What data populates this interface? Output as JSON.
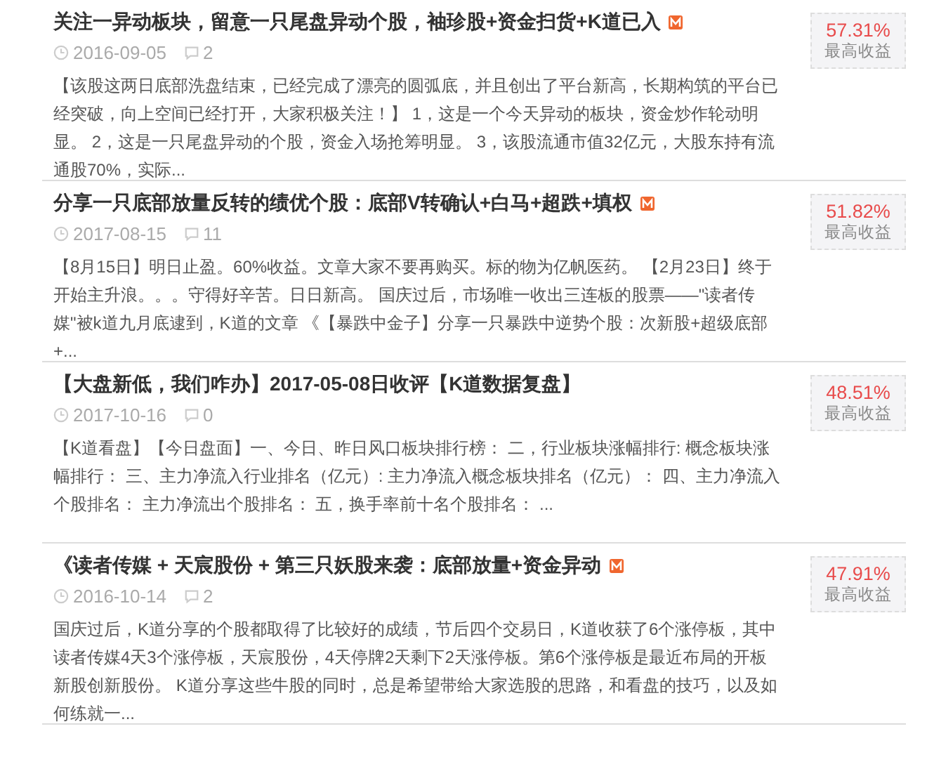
{
  "articles": [
    {
      "title": "关注一异动板块，留意一只尾盘异动个股，袖珍股+资金扫货+K道已入",
      "member": true,
      "date": "2016-09-05",
      "comments": "2",
      "summary": "【该股这两日底部洗盘结束，已经完成了漂亮的圆弧底，并且创出了平台新高，长期构筑的平台已经突破，向上空间已经打开，大家积极关注！】 1，这是一个今天异动的板块，资金炒作轮动明显。 2，这是一只尾盘异动的个股，资金入场抢筹明显。 3，该股流通市值32亿元，大股东持有流通股70%，实际...",
      "return": "57.31%",
      "return_label": "最高收益"
    },
    {
      "title": "分享一只底部放量反转的绩优个股：底部V转确认+白马+超跌+填权",
      "member": true,
      "date": "2017-08-15",
      "comments": "11",
      "summary": "【8月15日】明日止盈。60%收益。文章大家不要再购买。标的物为亿帆医药。 【2月23日】终于开始主升浪。。。守得好辛苦。日日新高。 国庆过后，市场唯一收出三连板的股票——\"读者传媒\"被k道九月底逮到，K道的文章 《【暴跌中金子】分享一只暴跌中逆势个股：次新股+超级底部+...",
      "return": "51.82%",
      "return_label": "最高收益"
    },
    {
      "title": "【大盘新低，我们咋办】2017-05-08日收评【K道数据复盘】",
      "member": false,
      "date": "2017-10-16",
      "comments": "0",
      "summary": "【K道看盘】【今日盘面】一、今日、昨日风口板块排行榜： 二，行业板块涨幅排行: 概念板块涨幅排行： 三、主力净流入行业排名（亿元）: 主力净流入概念板块排名（亿元）： 四、主力净流入个股排名： 主力净流出个股排名： 五，换手率前十名个股排名： ...",
      "return": "48.51%",
      "return_label": "最高收益"
    },
    {
      "title": "《读者传媒 + 天宸股份 + 第三只妖股来袭：底部放量+资金异动",
      "member": true,
      "date": "2016-10-14",
      "comments": "2",
      "summary": "国庆过后，K道分享的个股都取得了比较好的成绩，节后四个交易日，K道收获了6个涨停板，其中读者传媒4天3个涨停板，天宸股份，4天停牌2天剩下2天涨停板。第6个涨停板是最近布局的开板新股创新股份。 K道分享这些牛股的同时，总是希望带给大家选股的思路，和看盘的技巧，以及如何练就一...",
      "return": "47.91%",
      "return_label": "最高收益"
    }
  ]
}
